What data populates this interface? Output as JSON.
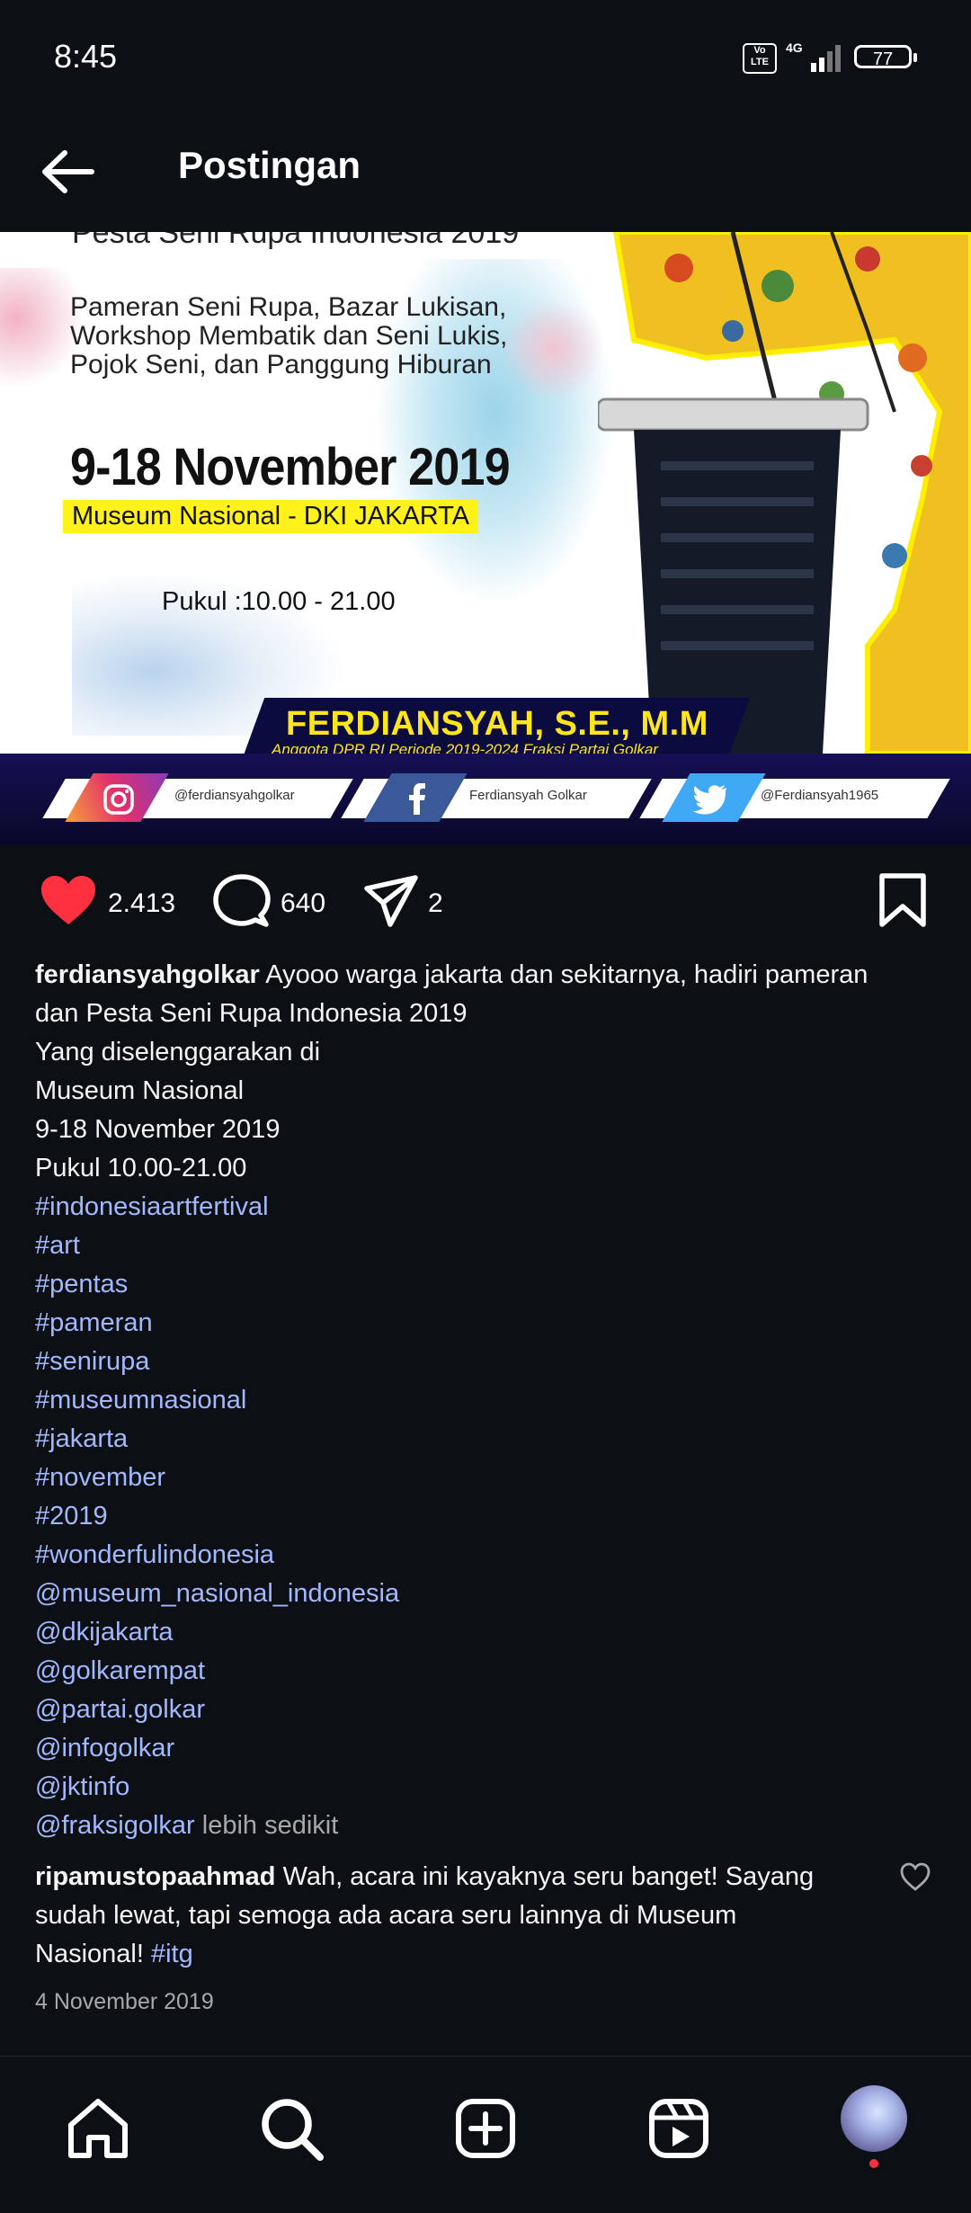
{
  "status_bar": {
    "time": "8:45",
    "volte": "Vo LTE",
    "network": "4G",
    "battery": "77"
  },
  "header": {
    "title": "Postingan"
  },
  "post_image": {
    "cut_title": "Pesta Seni Rupa Indonesia 2019",
    "desc_lines": [
      "Pameran Seni Rupa, Bazar Lukisan,",
      "Workshop Membatik dan Seni Lukis,",
      "Pojok Seni, dan Panggung Hiburan"
    ],
    "date": "9-18 November 2019",
    "venue": "Museum Nasional - DKI JAKARTA",
    "hours": "Pukul :10.00 - 21.00",
    "name": "FERDIANSYAH, S.E., M.M",
    "role": "Anggota DPR RI Periode 2019-2024 Fraksi Partai Golkar",
    "socials": [
      {
        "icon": "instagram-icon",
        "handle": "@ferdiansyahgolkar"
      },
      {
        "icon": "facebook-icon",
        "handle": "Ferdiansyah Golkar"
      },
      {
        "icon": "twitter-icon",
        "handle": "@Ferdiansyah1965"
      }
    ]
  },
  "actions": {
    "likes": "2.413",
    "comments": "640",
    "shares": "2"
  },
  "caption": {
    "username": "ferdiansyahgolkar",
    "text_line1": "Ayooo warga jakarta dan sekitarnya, hadiri pameran",
    "lines": [
      "dan Pesta Seni Rupa Indonesia 2019",
      "Yang diselenggarakan di",
      "Museum Nasional",
      "9-18 November 2019",
      "Pukul 10.00-21.00"
    ],
    "tags": [
      "#indonesiaartfertival",
      "#art",
      "#pentas",
      "#pameran",
      "#senirupa",
      "#museumnasional",
      "#jakarta",
      "#november",
      "#2019",
      "#wonderfulindonesia",
      "@museum_nasional_indonesia",
      "@dkijakarta",
      "@golkarempat",
      "@partai.golkar",
      "@infogolkar",
      "@jktinfo",
      "@fraksigolkar"
    ],
    "more": "lebih sedikit"
  },
  "comment": {
    "username": "ripamustopaahmad",
    "line1": "Wah, acara ini kayaknya seru banget! Sayang",
    "line2": "sudah lewat, tapi semoga ada acara seru lainnya di Museum",
    "line3": "Nasional!",
    "tag": "#itg"
  },
  "post_date": "4 November 2019",
  "bottom_nav": [
    "home-icon",
    "search-icon",
    "create-icon",
    "reels-icon",
    "profile-avatar"
  ],
  "colors": {
    "background": "#0c1014",
    "link": "#a2b8ff",
    "like_red": "#ff3040",
    "muted": "#a8a8a8"
  }
}
